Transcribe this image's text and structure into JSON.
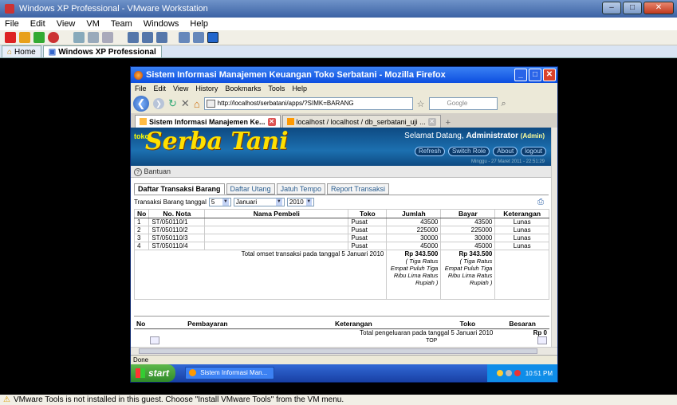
{
  "vmware": {
    "title": "Windows XP Professional - VMware Workstation",
    "menu": [
      "File",
      "Edit",
      "View",
      "VM",
      "Team",
      "Windows",
      "Help"
    ],
    "tabs": [
      {
        "label": "Home"
      },
      {
        "label": "Windows XP Professional"
      }
    ],
    "status": "VMware Tools is not installed in this guest. Choose \"Install VMware Tools\" from the VM menu."
  },
  "firefox": {
    "title": "Sistem Informasi Manajemen Keuangan Toko Serbatani - Mozilla Firefox",
    "menu": [
      "File",
      "Edit",
      "View",
      "History",
      "Bookmarks",
      "Tools",
      "Help"
    ],
    "url": "http://localhost/serbatani/apps/?SIMK=BARANG",
    "search_placeholder": "Google",
    "tabs": [
      {
        "label": "Sistem Informasi Manajemen Ke..."
      },
      {
        "label": "localhost / localhost / db_serbatani_uji ..."
      }
    ],
    "status": "Done"
  },
  "page": {
    "logo_small": "toko",
    "logo_main": "Serba Tani",
    "welcome_prefix": "Selamat Datang,",
    "welcome_user": "Administrator",
    "welcome_role": "(Admin)",
    "header_buttons": [
      "Refresh",
      "Switch Role",
      "About",
      "logout"
    ],
    "date_line": "Minggu - 27 Maret 2011 - 22:51:29",
    "help_label": "Bantuan",
    "tabs": [
      "Daftar Transaksi Barang",
      "Daftar Utang",
      "Jatuh Tempo",
      "Report Transaksi"
    ],
    "filter": {
      "label": "Transaksi Barang tanggal",
      "day": "5",
      "month": "Januari",
      "year": "2010"
    },
    "table1": {
      "headers": [
        "No",
        "No. Nota",
        "Nama Pembeli",
        "Toko",
        "Jumlah",
        "Bayar",
        "Keterangan"
      ],
      "rows": [
        [
          "1",
          "ST/050110/1",
          "",
          "Pusat",
          "43500",
          "43500",
          "Lunas"
        ],
        [
          "2",
          "ST/050110/2",
          "",
          "Pusat",
          "225000",
          "225000",
          "Lunas"
        ],
        [
          "3",
          "ST/050110/3",
          "",
          "Pusat",
          "30000",
          "30000",
          "Lunas"
        ],
        [
          "4",
          "ST/050110/4",
          "",
          "Pusat",
          "45000",
          "45000",
          "Lunas"
        ]
      ],
      "total_label": "Total omset transaksi pada tanggal 5 Januari 2010",
      "total_jumlah": "Rp 343.500",
      "total_jumlah_words": "( Tiga Ratus Empat Puluh Tiga Ribu Lima Ratus Rupiah )",
      "total_bayar": "Rp 343.500",
      "total_bayar_words": "( Tiga Ratus Empat Puluh Tiga Ribu Lima Ratus Rupiah )"
    },
    "table2": {
      "headers": [
        "No",
        "Pembayaran",
        "Keterangan",
        "Toko",
        "Besaran"
      ],
      "total_label": "Total pengeluaran pada tanggal 5 Januari 2010",
      "total_value": "Rp 0",
      "top_link": "TOP"
    }
  },
  "taskbar": {
    "start": "start",
    "item": "Sistem Informasi Man...",
    "clock": "10:51 PM"
  }
}
